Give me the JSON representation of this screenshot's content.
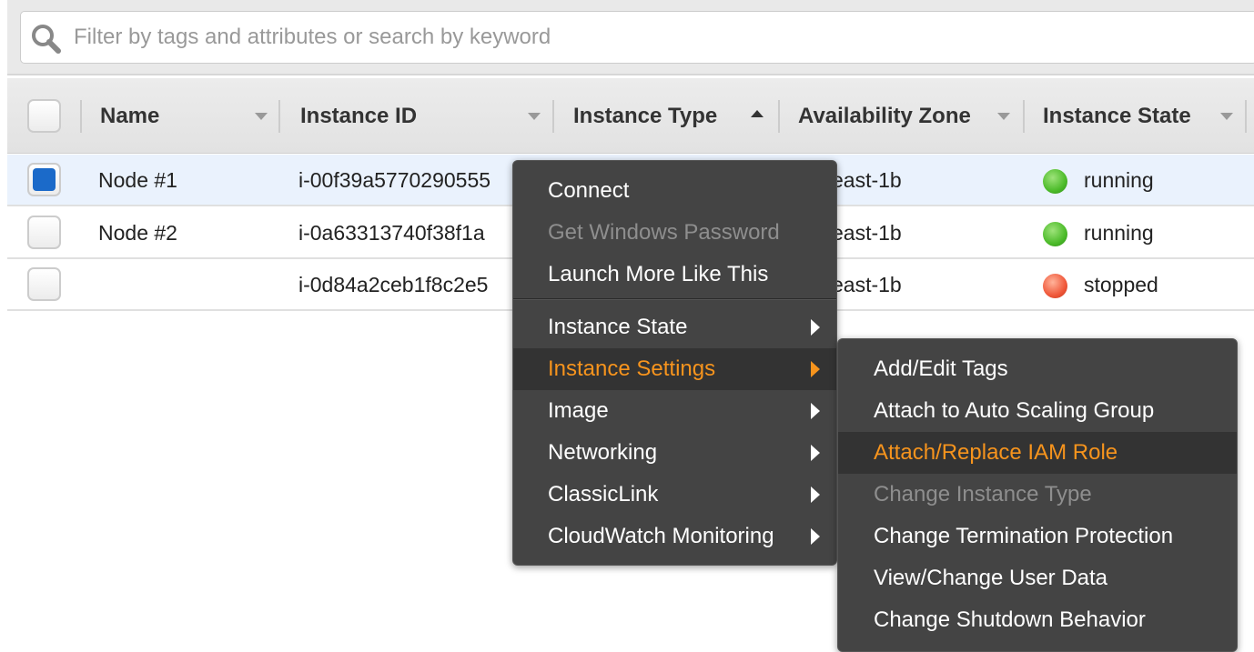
{
  "search": {
    "placeholder": "Filter by tags and attributes or search by keyword",
    "icon": "search-icon"
  },
  "columns": [
    {
      "label": "Name",
      "sort": "none"
    },
    {
      "label": "Instance ID",
      "sort": "none"
    },
    {
      "label": "Instance Type",
      "sort": "ascending"
    },
    {
      "label": "Availability Zone",
      "sort": "none"
    },
    {
      "label": "Instance State",
      "sort": "none"
    }
  ],
  "rows": [
    {
      "selected": true,
      "name": "Node #1",
      "id": "i-00f39a5770290555",
      "az": "east-1b",
      "state": "running",
      "state_color": "#4cbb2a"
    },
    {
      "selected": false,
      "name": "Node #2",
      "id": "i-0a63313740f38f1a",
      "az": "east-1b",
      "state": "running",
      "state_color": "#4cbb2a"
    },
    {
      "selected": false,
      "name": "",
      "id": "i-0d84a2ceb1f8c2e5",
      "az": "east-1b",
      "state": "stopped",
      "state_color": "#f0583a"
    }
  ],
  "context_menu": {
    "items": [
      {
        "label": "Connect"
      },
      {
        "label": "Get Windows Password",
        "disabled": true
      },
      {
        "label": "Launch More Like This"
      },
      {
        "label": "Instance State",
        "submenu": true
      },
      {
        "label": "Instance Settings",
        "submenu": true,
        "highlighted": true
      },
      {
        "label": "Image",
        "submenu": true
      },
      {
        "label": "Networking",
        "submenu": true
      },
      {
        "label": "ClassicLink",
        "submenu": true
      },
      {
        "label": "CloudWatch Monitoring",
        "submenu": true
      }
    ]
  },
  "submenu": {
    "items": [
      {
        "label": "Add/Edit Tags"
      },
      {
        "label": "Attach to Auto Scaling Group"
      },
      {
        "label": "Attach/Replace IAM Role",
        "highlighted": true
      },
      {
        "label": "Change Instance Type",
        "disabled": true
      },
      {
        "label": "Change Termination Protection"
      },
      {
        "label": "View/Change User Data"
      },
      {
        "label": "Change Shutdown Behavior"
      }
    ]
  },
  "colors": {
    "accent": "#f7941d",
    "menu_bg": "#444444",
    "selected_row": "#eaf2fd",
    "checkbox_on": "#1b6ac9"
  }
}
